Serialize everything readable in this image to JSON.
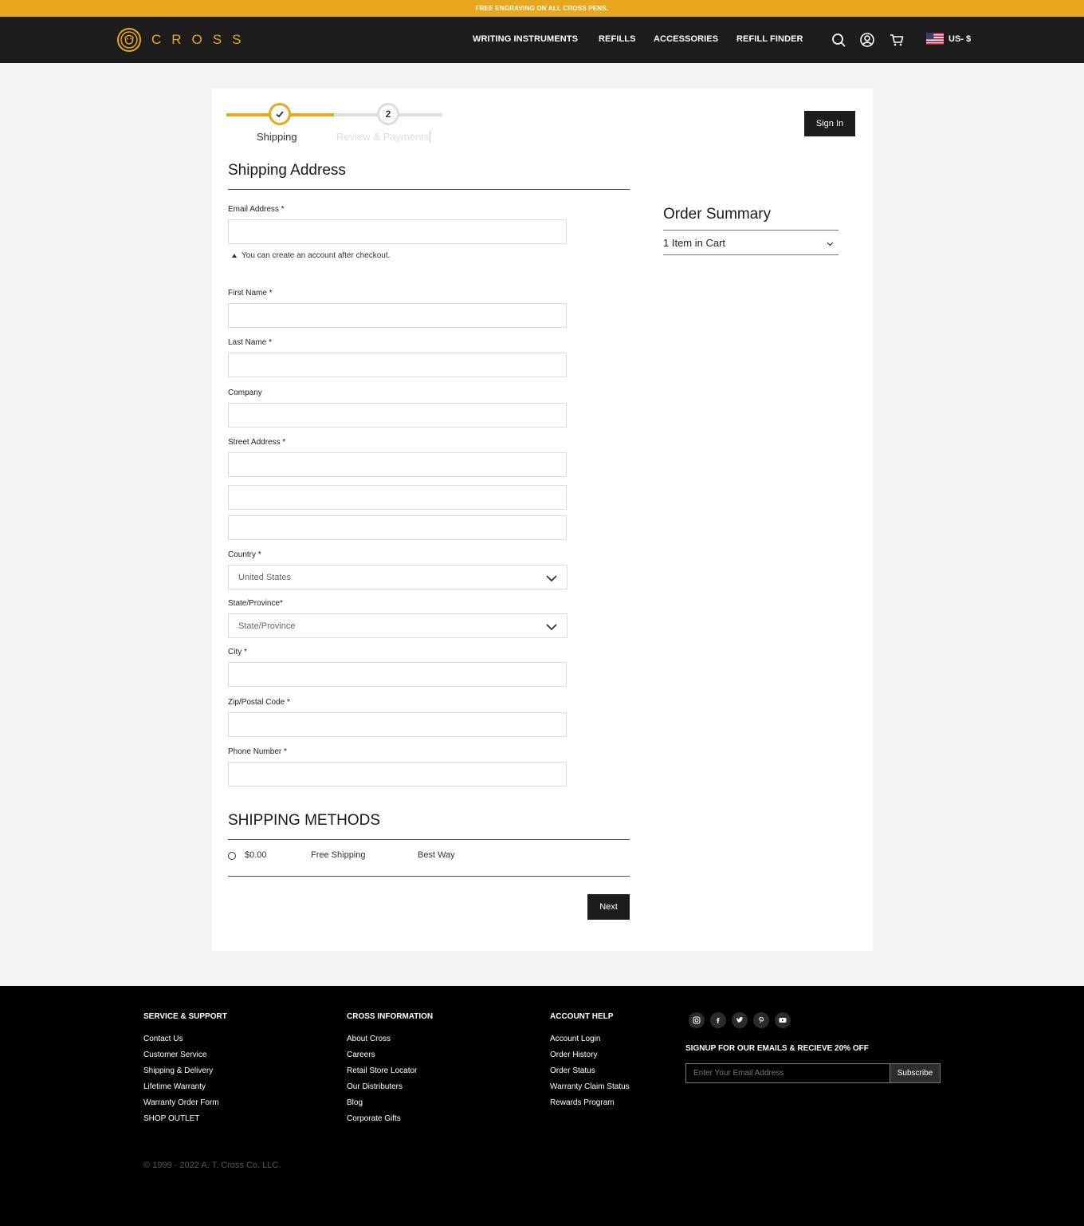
{
  "promo": {
    "text": "FREE ENGRAVING ON ALL CROSS PENS."
  },
  "brand": {
    "name": "CROSS",
    "accent": "#e9a720",
    "dark": "#1c1c1c"
  },
  "nav": {
    "items": [
      {
        "label": "WRITING INSTRUMENTS"
      },
      {
        "label": "REFILLS"
      },
      {
        "label": "ACCESSORIES"
      },
      {
        "label": "REFILL FINDER"
      }
    ],
    "icons": [
      "search-icon",
      "account-icon",
      "cart-icon"
    ],
    "locale": {
      "flag": "us-flag-icon",
      "label": "US- $"
    }
  },
  "checkout": {
    "steps": [
      {
        "label": "Shipping",
        "state": "complete"
      },
      {
        "label": "Review & Payments",
        "number": "2",
        "state": "pending"
      }
    ],
    "sign_in": "Sign In",
    "shipping_address_title": "Shipping Address",
    "fields": {
      "email": {
        "label": "Email Address *",
        "value": ""
      },
      "account_hint": "You can create an account after checkout.",
      "first_name": {
        "label": "First Name *",
        "value": ""
      },
      "last_name": {
        "label": "Last Name *",
        "value": ""
      },
      "company": {
        "label": "Company",
        "value": ""
      },
      "street": {
        "label": "Street Address *",
        "line1": "",
        "line2": "",
        "line3": ""
      },
      "country": {
        "label": "Country *",
        "selected": "United States"
      },
      "state": {
        "label": "State/Province*",
        "selected": "State/Province"
      },
      "city": {
        "label": "City *",
        "value": ""
      },
      "zip": {
        "label": "Zip/Postal Code *",
        "value": ""
      },
      "phone": {
        "label": "Phone Number *",
        "value": ""
      }
    },
    "shipping_methods_title": "SHIPPING METHODS",
    "shipping_methods": [
      {
        "price": "$0.00",
        "method": "Free Shipping",
        "carrier": "Best Way",
        "selected": false
      }
    ],
    "next": "Next"
  },
  "order_summary": {
    "title": "Order Summary",
    "cart_count": "1 Item in Cart"
  },
  "footer": {
    "columns": [
      {
        "heading": "SERVICE & SUPPORT",
        "links": [
          "Contact Us",
          "Customer Service",
          "Shipping & Delivery",
          "Lifetime Warranty",
          "Warranty Order Form",
          "SHOP OUTLET"
        ]
      },
      {
        "heading": "CROSS INFORMATION",
        "links": [
          "About Cross",
          "Careers",
          "Retail Store Locator",
          "Our Distributers",
          "Blog",
          "Corporate Gifts"
        ]
      },
      {
        "heading": "ACCOUNT HELP",
        "links": [
          "Account Login",
          "Order History",
          "Order Status",
          "Warranty Claim Status",
          "Rewards Program"
        ]
      }
    ],
    "social": [
      "instagram-icon",
      "facebook-icon",
      "twitter-icon",
      "pinterest-icon",
      "youtube-icon"
    ],
    "signup_heading": "SIGNUP FOR OUR EMAILS & RECIEVE 20% OFF",
    "signup_placeholder": "Enter Your Email Address",
    "subscribe": "Subscribe",
    "copyright": "© 1999 - 2022 A. T. Cross Co. LLC."
  }
}
